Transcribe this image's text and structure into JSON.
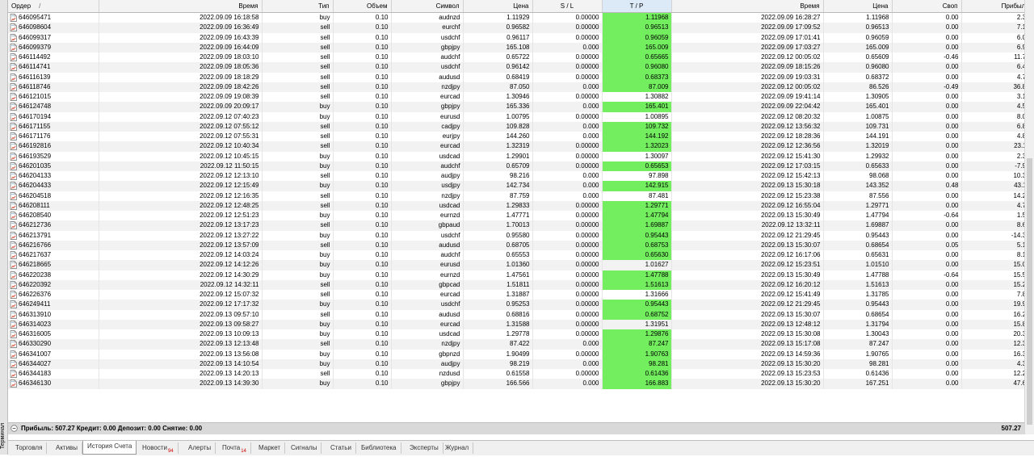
{
  "side_panel": {
    "label": "Терминал"
  },
  "columns": [
    {
      "label": "Ордер",
      "sort_icon": "/"
    },
    {
      "label": "Время"
    },
    {
      "label": "Тип"
    },
    {
      "label": "Объем"
    },
    {
      "label": "Символ"
    },
    {
      "label": "Цена"
    },
    {
      "label": "S / L"
    },
    {
      "label": "T / P"
    },
    {
      "label": "Время"
    },
    {
      "label": "Цена"
    },
    {
      "label": "Своп"
    },
    {
      "label": "Прибыль"
    }
  ],
  "rows": [
    {
      "order": "646095471",
      "open_time": "2022.09.09 16:18:58",
      "type": "buy",
      "volume": "0.10",
      "symbol": "audnzd",
      "open_price": "1.11929",
      "sl": "0.00000",
      "tp": "1.11968",
      "tp_hit": true,
      "close_time": "2022.09.09 16:28:27",
      "close_price": "1.11968",
      "swap": "0.00",
      "profit": "2.36"
    },
    {
      "order": "646098604",
      "open_time": "2022.09.09 16:36:49",
      "type": "sell",
      "volume": "0.10",
      "symbol": "eurchf",
      "open_price": "0.96582",
      "sl": "0.00000",
      "tp": "0.96513",
      "tp_hit": true,
      "close_time": "2022.09.09 17:09:52",
      "close_price": "0.96513",
      "swap": "0.00",
      "profit": "7.19"
    },
    {
      "order": "646099317",
      "open_time": "2022.09.09 16:43:39",
      "type": "sell",
      "volume": "0.10",
      "symbol": "usdchf",
      "open_price": "0.96117",
      "sl": "0.00000",
      "tp": "0.96059",
      "tp_hit": true,
      "close_time": "2022.09.09 17:01:41",
      "close_price": "0.96059",
      "swap": "0.00",
      "profit": "6.04"
    },
    {
      "order": "646099379",
      "open_time": "2022.09.09 16:44:09",
      "type": "sell",
      "volume": "0.10",
      "symbol": "gbpjpy",
      "open_price": "165.108",
      "sl": "0.000",
      "tp": "165.009",
      "tp_hit": true,
      "close_time": "2022.09.09 17:03:27",
      "close_price": "165.009",
      "swap": "0.00",
      "profit": "6.95"
    },
    {
      "order": "646114492",
      "open_time": "2022.09.09 18:03:10",
      "type": "sell",
      "volume": "0.10",
      "symbol": "audchf",
      "open_price": "0.65722",
      "sl": "0.00000",
      "tp": "0.65665",
      "tp_hit": true,
      "close_time": "2022.09.12 00:05:02",
      "close_price": "0.65609",
      "swap": "-0.46",
      "profit": "11.78"
    },
    {
      "order": "646114741",
      "open_time": "2022.09.09 18:05:36",
      "type": "sell",
      "volume": "0.10",
      "symbol": "usdchf",
      "open_price": "0.96142",
      "sl": "0.00000",
      "tp": "0.96080",
      "tp_hit": true,
      "close_time": "2022.09.09 18:15:26",
      "close_price": "0.96080",
      "swap": "0.00",
      "profit": "6.45"
    },
    {
      "order": "646116139",
      "open_time": "2022.09.09 18:18:29",
      "type": "sell",
      "volume": "0.10",
      "symbol": "audusd",
      "open_price": "0.68419",
      "sl": "0.00000",
      "tp": "0.68373",
      "tp_hit": true,
      "close_time": "2022.09.09 19:03:31",
      "close_price": "0.68372",
      "swap": "0.00",
      "profit": "4.70"
    },
    {
      "order": "646118746",
      "open_time": "2022.09.09 18:42:26",
      "type": "sell",
      "volume": "0.10",
      "symbol": "nzdjpy",
      "open_price": "87.050",
      "sl": "0.000",
      "tp": "87.009",
      "tp_hit": true,
      "close_time": "2022.09.12 00:05:02",
      "close_price": "86.526",
      "swap": "-0.49",
      "profit": "36.86"
    },
    {
      "order": "646121015",
      "open_time": "2022.09.09 19:08:39",
      "type": "sell",
      "volume": "0.10",
      "symbol": "eurcad",
      "open_price": "1.30946",
      "sl": "0.00000",
      "tp": "1.30882",
      "tp_hit": false,
      "close_time": "2022.09.09 19:41:14",
      "close_price": "1.30905",
      "swap": "0.00",
      "profit": "3.15"
    },
    {
      "order": "646124748",
      "open_time": "2022.09.09 20:09:17",
      "type": "buy",
      "volume": "0.10",
      "symbol": "gbpjpy",
      "open_price": "165.336",
      "sl": "0.000",
      "tp": "165.401",
      "tp_hit": true,
      "close_time": "2022.09.09 22:04:42",
      "close_price": "165.401",
      "swap": "0.00",
      "profit": "4.55"
    },
    {
      "order": "646170194",
      "open_time": "2022.09.12 07:40:23",
      "type": "buy",
      "volume": "0.10",
      "symbol": "eurusd",
      "open_price": "1.00795",
      "sl": "0.00000",
      "tp": "1.00895",
      "tp_hit": false,
      "close_time": "2022.09.12 08:20:32",
      "close_price": "1.00875",
      "swap": "0.00",
      "profit": "8.00"
    },
    {
      "order": "646171155",
      "open_time": "2022.09.12 07:55:12",
      "type": "sell",
      "volume": "0.10",
      "symbol": "cadjpy",
      "open_price": "109.828",
      "sl": "0.000",
      "tp": "109.732",
      "tp_hit": true,
      "close_time": "2022.09.12 13:56:32",
      "close_price": "109.731",
      "swap": "0.00",
      "profit": "6.80"
    },
    {
      "order": "646171176",
      "open_time": "2022.09.12 07:55:31",
      "type": "sell",
      "volume": "0.10",
      "symbol": "eurjpy",
      "open_price": "144.260",
      "sl": "0.000",
      "tp": "144.192",
      "tp_hit": true,
      "close_time": "2022.09.12 18:28:36",
      "close_price": "144.191",
      "swap": "0.00",
      "profit": "4.85"
    },
    {
      "order": "646192816",
      "open_time": "2022.09.12 10:40:34",
      "type": "sell",
      "volume": "0.10",
      "symbol": "eurcad",
      "open_price": "1.32319",
      "sl": "0.00000",
      "tp": "1.32023",
      "tp_hit": true,
      "close_time": "2022.09.12 12:36:56",
      "close_price": "1.32019",
      "swap": "0.00",
      "profit": "23.11"
    },
    {
      "order": "646193529",
      "open_time": "2022.09.12 10:45:15",
      "type": "buy",
      "volume": "0.10",
      "symbol": "usdcad",
      "open_price": "1.29901",
      "sl": "0.00000",
      "tp": "1.30097",
      "tp_hit": false,
      "close_time": "2022.09.12 15:41:30",
      "close_price": "1.29932",
      "swap": "0.00",
      "profit": "2.39"
    },
    {
      "order": "646201035",
      "open_time": "2022.09.12 11:50:15",
      "type": "buy",
      "volume": "0.10",
      "symbol": "audchf",
      "open_price": "0.65709",
      "sl": "0.00000",
      "tp": "0.65653",
      "tp_hit": true,
      "close_time": "2022.09.12 17:03:15",
      "close_price": "0.65633",
      "swap": "0.00",
      "profit": "-7.97"
    },
    {
      "order": "646204133",
      "open_time": "2022.09.12 12:13:10",
      "type": "sell",
      "volume": "0.10",
      "symbol": "audjpy",
      "open_price": "98.216",
      "sl": "0.000",
      "tp": "97.898",
      "tp_hit": false,
      "close_time": "2022.09.12 15:42:13",
      "close_price": "98.068",
      "swap": "0.00",
      "profit": "10.38"
    },
    {
      "order": "646204433",
      "open_time": "2022.09.12 12:15:49",
      "type": "buy",
      "volume": "0.10",
      "symbol": "usdjpy",
      "open_price": "142.734",
      "sl": "0.000",
      "tp": "142.915",
      "tp_hit": true,
      "close_time": "2022.09.13 15:30:18",
      "close_price": "143.352",
      "swap": "0.48",
      "profit": "43.11"
    },
    {
      "order": "646204518",
      "open_time": "2022.09.12 12:16:35",
      "type": "sell",
      "volume": "0.10",
      "symbol": "nzdjpy",
      "open_price": "87.759",
      "sl": "0.000",
      "tp": "87.481",
      "tp_hit": false,
      "close_time": "2022.09.12 15:23:38",
      "close_price": "87.556",
      "swap": "0.00",
      "profit": "14.26"
    },
    {
      "order": "646208111",
      "open_time": "2022.09.12 12:48:25",
      "type": "sell",
      "volume": "0.10",
      "symbol": "usdcad",
      "open_price": "1.29833",
      "sl": "0.00000",
      "tp": "1.29771",
      "tp_hit": true,
      "close_time": "2022.09.12 16:55:04",
      "close_price": "1.29771",
      "swap": "0.00",
      "profit": "4.78"
    },
    {
      "order": "646208540",
      "open_time": "2022.09.12 12:51:23",
      "type": "buy",
      "volume": "0.10",
      "symbol": "eurnzd",
      "open_price": "1.47771",
      "sl": "0.00000",
      "tp": "1.47794",
      "tp_hit": true,
      "close_time": "2022.09.13 15:30:49",
      "close_price": "1.47794",
      "swap": "-0.64",
      "profit": "1.57"
    },
    {
      "order": "646212736",
      "open_time": "2022.09.12 13:17:23",
      "type": "sell",
      "volume": "0.10",
      "symbol": "gbpaud",
      "open_price": "1.70013",
      "sl": "0.00000",
      "tp": "1.69887",
      "tp_hit": true,
      "close_time": "2022.09.12 13:32:11",
      "close_price": "1.69887",
      "swap": "0.00",
      "profit": "8.65"
    },
    {
      "order": "646213791",
      "open_time": "2022.09.12 13:27:22",
      "type": "buy",
      "volume": "0.10",
      "symbol": "usdchf",
      "open_price": "0.95580",
      "sl": "0.00000",
      "tp": "0.95443",
      "tp_hit": true,
      "close_time": "2022.09.12 21:29:45",
      "close_price": "0.95443",
      "swap": "0.00",
      "profit": "-14.35"
    },
    {
      "order": "646216766",
      "open_time": "2022.09.12 13:57:09",
      "type": "sell",
      "volume": "0.10",
      "symbol": "audusd",
      "open_price": "0.68705",
      "sl": "0.00000",
      "tp": "0.68753",
      "tp_hit": true,
      "close_time": "2022.09.13 15:30:07",
      "close_price": "0.68654",
      "swap": "0.05",
      "profit": "5.10"
    },
    {
      "order": "646217637",
      "open_time": "2022.09.12 14:03:24",
      "type": "buy",
      "volume": "0.10",
      "symbol": "audchf",
      "open_price": "0.65553",
      "sl": "0.00000",
      "tp": "0.65630",
      "tp_hit": true,
      "close_time": "2022.09.12 16:17:06",
      "close_price": "0.65631",
      "swap": "0.00",
      "profit": "8.18"
    },
    {
      "order": "646218665",
      "open_time": "2022.09.12 14:12:26",
      "type": "buy",
      "volume": "0.10",
      "symbol": "eurusd",
      "open_price": "1.01360",
      "sl": "0.00000",
      "tp": "1.01627",
      "tp_hit": false,
      "close_time": "2022.09.12 15:23:51",
      "close_price": "1.01510",
      "swap": "0.00",
      "profit": "15.00"
    },
    {
      "order": "646220238",
      "open_time": "2022.09.12 14:30:29",
      "type": "buy",
      "volume": "0.10",
      "symbol": "eurnzd",
      "open_price": "1.47561",
      "sl": "0.00000",
      "tp": "1.47788",
      "tp_hit": true,
      "close_time": "2022.09.13 15:30:49",
      "close_price": "1.47788",
      "swap": "-0.64",
      "profit": "15.52"
    },
    {
      "order": "646220392",
      "open_time": "2022.09.12 14:32:11",
      "type": "sell",
      "volume": "0.10",
      "symbol": "gbpcad",
      "open_price": "1.51811",
      "sl": "0.00000",
      "tp": "1.51613",
      "tp_hit": true,
      "close_time": "2022.09.12 16:20:12",
      "close_price": "1.51613",
      "swap": "0.00",
      "profit": "15.24"
    },
    {
      "order": "646226376",
      "open_time": "2022.09.12 15:07:32",
      "type": "sell",
      "volume": "0.10",
      "symbol": "eurcad",
      "open_price": "1.31887",
      "sl": "0.00000",
      "tp": "1.31666",
      "tp_hit": false,
      "close_time": "2022.09.12 15:41:49",
      "close_price": "1.31785",
      "swap": "0.00",
      "profit": "7.85"
    },
    {
      "order": "646249411",
      "open_time": "2022.09.12 17:17:32",
      "type": "buy",
      "volume": "0.10",
      "symbol": "usdchf",
      "open_price": "0.95253",
      "sl": "0.00000",
      "tp": "0.95443",
      "tp_hit": true,
      "close_time": "2022.09.12 21:29:45",
      "close_price": "0.95443",
      "swap": "0.00",
      "profit": "19.91"
    },
    {
      "order": "646313910",
      "open_time": "2022.09.13 09:57:10",
      "type": "sell",
      "volume": "0.10",
      "symbol": "audusd",
      "open_price": "0.68816",
      "sl": "0.00000",
      "tp": "0.68752",
      "tp_hit": true,
      "close_time": "2022.09.13 15:30:07",
      "close_price": "0.68654",
      "swap": "0.00",
      "profit": "16.20"
    },
    {
      "order": "646314023",
      "open_time": "2022.09.13 09:58:27",
      "type": "buy",
      "volume": "0.10",
      "symbol": "eurcad",
      "open_price": "1.31588",
      "sl": "0.00000",
      "tp": "1.31951",
      "tp_hit": false,
      "close_time": "2022.09.13 12:48:12",
      "close_price": "1.31794",
      "swap": "0.00",
      "profit": "15.89"
    },
    {
      "order": "646316005",
      "open_time": "2022.09.13 10:09:13",
      "type": "buy",
      "volume": "0.10",
      "symbol": "usdcad",
      "open_price": "1.29778",
      "sl": "0.00000",
      "tp": "1.29876",
      "tp_hit": true,
      "close_time": "2022.09.13 15:30:08",
      "close_price": "1.30043",
      "swap": "0.00",
      "profit": "20.38"
    },
    {
      "order": "646330290",
      "open_time": "2022.09.13 12:13:48",
      "type": "sell",
      "volume": "0.10",
      "symbol": "nzdjpy",
      "open_price": "87.422",
      "sl": "0.000",
      "tp": "87.247",
      "tp_hit": true,
      "close_time": "2022.09.13 15:17:08",
      "close_price": "87.247",
      "swap": "0.00",
      "profit": "12.33"
    },
    {
      "order": "646341007",
      "open_time": "2022.09.13 13:56:08",
      "type": "buy",
      "volume": "0.10",
      "symbol": "gbpnzd",
      "open_price": "1.90499",
      "sl": "0.00000",
      "tp": "1.90763",
      "tp_hit": true,
      "close_time": "2022.09.13 14:59:36",
      "close_price": "1.90765",
      "swap": "0.00",
      "profit": "16.36"
    },
    {
      "order": "646344027",
      "open_time": "2022.09.13 14:10:54",
      "type": "buy",
      "volume": "0.10",
      "symbol": "audjpy",
      "open_price": "98.219",
      "sl": "0.000",
      "tp": "98.281",
      "tp_hit": true,
      "close_time": "2022.09.13 15:30:20",
      "close_price": "98.281",
      "swap": "0.00",
      "profit": "4.32"
    },
    {
      "order": "646344183",
      "open_time": "2022.09.13 14:20:13",
      "type": "sell",
      "volume": "0.10",
      "symbol": "nzdusd",
      "open_price": "0.61558",
      "sl": "0.00000",
      "tp": "0.61436",
      "tp_hit": true,
      "close_time": "2022.09.13 15:23:53",
      "close_price": "0.61436",
      "swap": "0.00",
      "profit": "12.20"
    },
    {
      "order": "646346130",
      "open_time": "2022.09.13 14:39:30",
      "type": "buy",
      "volume": "0.10",
      "symbol": "gbpjpy",
      "open_price": "166.566",
      "sl": "0.000",
      "tp": "166.883",
      "tp_hit": true,
      "close_time": "2022.09.13 15:30:20",
      "close_price": "167.251",
      "swap": "0.00",
      "profit": "47.67"
    }
  ],
  "summary": {
    "text": "Прибыль: 507.27  Кредит: 0.00  Депозит: 0.00  Снятие: 0.00",
    "total": "507.27"
  },
  "tabs": [
    {
      "label": "Торговля",
      "badge": ""
    },
    {
      "label": "Активы",
      "badge": ""
    },
    {
      "label": "История Счета",
      "badge": "",
      "active": true
    },
    {
      "label": "Новости",
      "badge": "94"
    },
    {
      "label": "Алерты",
      "badge": ""
    },
    {
      "label": "Почта",
      "badge": "14"
    },
    {
      "label": "Маркет",
      "badge": ""
    },
    {
      "label": "Сигналы",
      "badge": ""
    },
    {
      "label": "Статьи",
      "badge": ""
    },
    {
      "label": "Библиотека",
      "badge": ""
    },
    {
      "label": "Эксперты",
      "badge": ""
    },
    {
      "label": "Журнал",
      "badge": ""
    }
  ],
  "colors": {
    "tp_highlight": "#72ee5e",
    "row_alt": "#f2f2f2",
    "header_bg": "#f3f3f3",
    "header_active": "#dce9f6",
    "summary_bg": "#d9d9d9",
    "badge": "#d00000"
  }
}
